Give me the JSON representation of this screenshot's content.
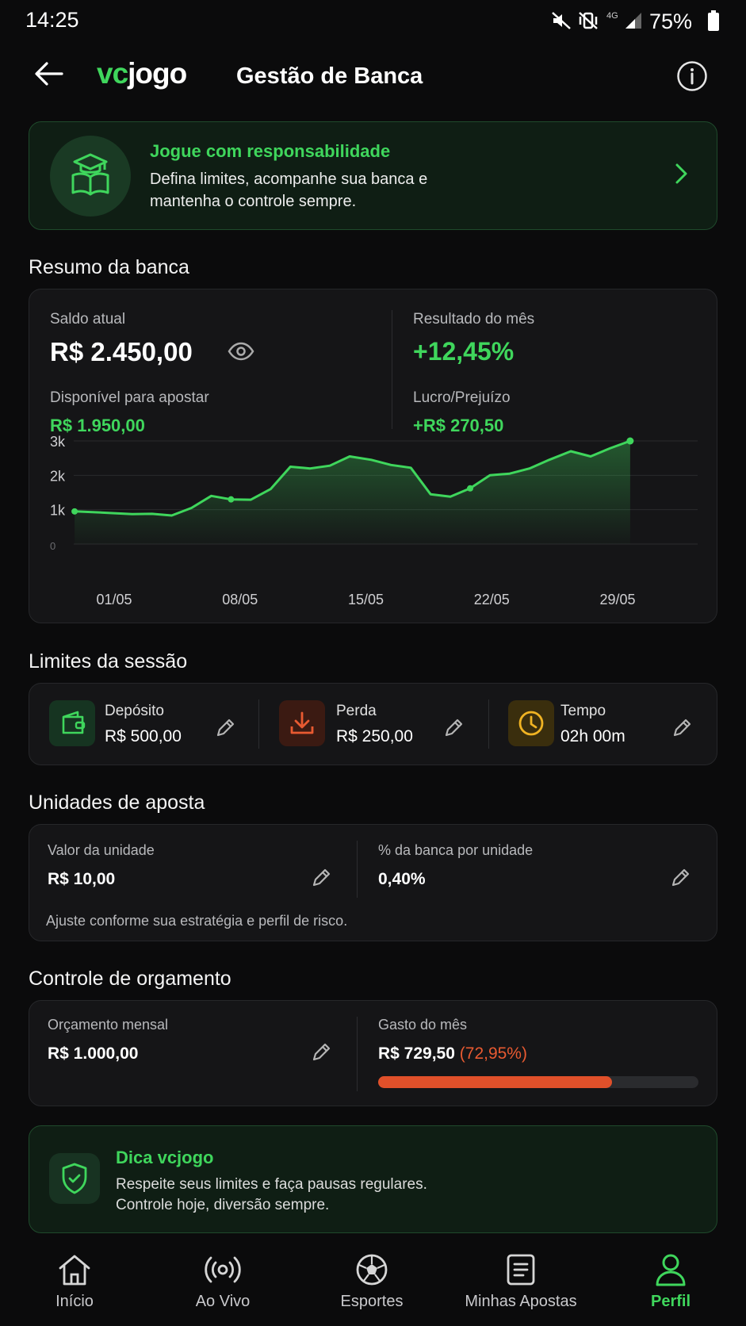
{
  "status_bar": {
    "time": "14:25",
    "network": "4G",
    "battery": "75%"
  },
  "header": {
    "brand_prefix": "vc",
    "brand_suffix": "jogo",
    "title": "Gestão de Banca"
  },
  "banner": {
    "title": "Jogue com responsabilidade",
    "line1": "Defina limites, acompanhe sua banca e",
    "line2": "mantenha o controle sempre."
  },
  "summary": {
    "section_title": "Resumo da banca",
    "balance_label": "Saldo atual",
    "balance_value": "R$ 2.450,00",
    "available_label": "Disponível para apostar",
    "available_value": "R$ 1.950,00",
    "month_result_label": "Resultado do mês",
    "month_result_value": "+12,45%",
    "profit_label": "Lucro/Prejuízo",
    "profit_value": "+R$ 270,50"
  },
  "chart_data": {
    "type": "area",
    "title": "",
    "xlabel": "",
    "ylabel": "",
    "ylim": [
      0,
      3000
    ],
    "yticks": [
      "0",
      "1k",
      "2k",
      "3k"
    ],
    "xticks": [
      "01/05",
      "08/05",
      "15/05",
      "22/05",
      "29/05"
    ],
    "grid": true,
    "color": "#3fd65c",
    "series": [
      {
        "x": [
          -1.2,
          -0.2,
          0.9,
          2.0,
          3.1,
          4.2,
          5.3,
          6.4,
          7.5,
          8.6,
          9.7,
          10.8,
          11.9,
          13.0,
          14.1,
          15.3,
          16.4,
          17.5,
          18.6,
          19.7,
          20.8,
          21.9,
          23.0,
          24.1,
          25.2,
          26.4,
          27.5,
          28.6,
          29.7
        ],
        "y": [
          950,
          930,
          900,
          870,
          880,
          830,
          1050,
          1400,
          1300,
          1290,
          1600,
          2250,
          2200,
          2280,
          2550,
          2450,
          2300,
          2220,
          1450,
          1380,
          1620,
          2000,
          2050,
          2200,
          2450,
          2700,
          2550,
          2790,
          3000
        ]
      }
    ]
  },
  "limits": {
    "section_title": "Limites da sessão",
    "items": [
      {
        "label": "Depósito",
        "value": "R$ 500,00"
      },
      {
        "label": "Perda",
        "value": "R$ 250,00"
      },
      {
        "label": "Tempo",
        "value": "02h 00m"
      }
    ]
  },
  "units": {
    "section_title": "Unidades de aposta",
    "unit_label": "Valor da unidade",
    "unit_value": "R$ 10,00",
    "pct_label": "% da banca por unidade",
    "pct_value": "0,40%",
    "note": "Ajuste conforme sua estratégia e perfil de risco."
  },
  "budget": {
    "section_title": "Controle de orgamento",
    "monthly_label": "Orçamento mensal",
    "monthly_value": "R$ 1.000,00",
    "spent_label": "Gasto do mês",
    "spent_value": "R$ 729,50",
    "spent_pct": "(72,95%)",
    "progress": 0.7295,
    "bar_color": "#e0502a"
  },
  "tip": {
    "title": "Dica vcjogo",
    "line1": "Respeite seus limites e faça pausas regulares.",
    "line2": "Controle hoje, diversão sempre."
  },
  "bottom_nav": [
    {
      "label": "Início",
      "icon": "home-icon"
    },
    {
      "label": "Ao Vivo",
      "icon": "live-broadcast-icon"
    },
    {
      "label": "Esportes",
      "icon": "soccer-ball-icon"
    },
    {
      "label": "Minhas Apostas",
      "icon": "bet-slip-icon"
    },
    {
      "label": "Perfil",
      "icon": "profile-icon",
      "active": true
    }
  ]
}
